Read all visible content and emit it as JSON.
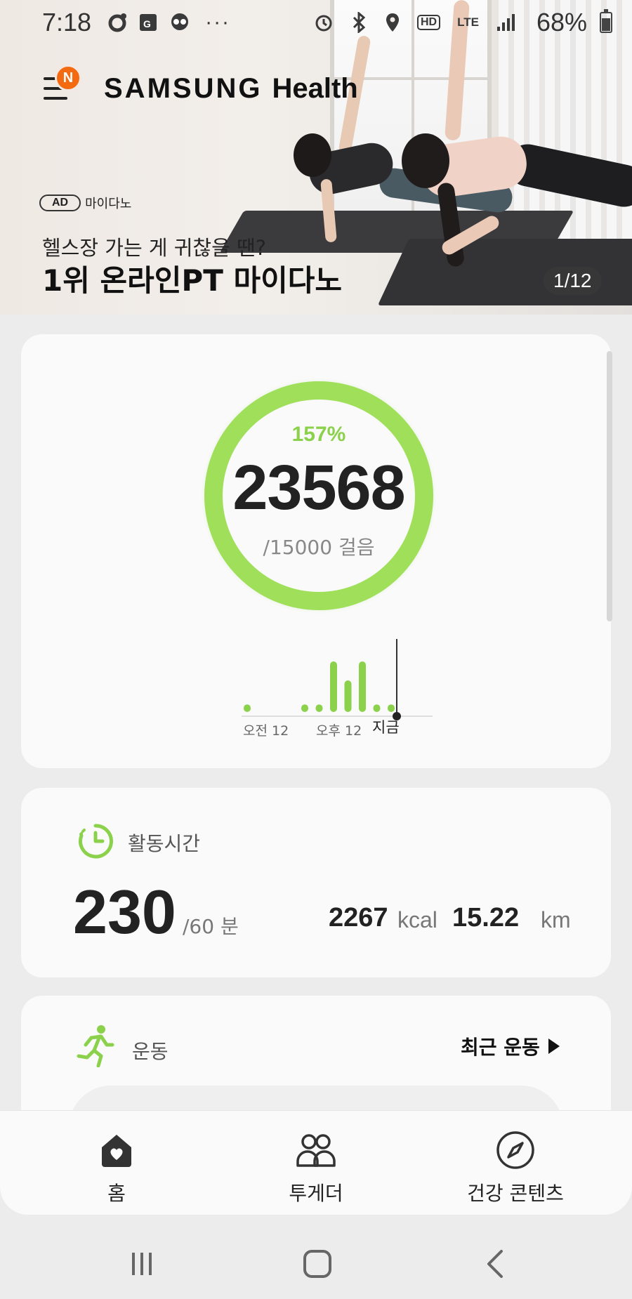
{
  "status_bar": {
    "time": "7:18",
    "icons_left": [
      "sync-icon",
      "map-icon",
      "skull-icon"
    ],
    "more": "···",
    "icons_right": [
      "alarm-icon",
      "bluetooth-icon",
      "location-icon",
      "hd-icon",
      "lte-icon",
      "signal-icon"
    ],
    "lte": "LTE",
    "hd": "HD",
    "battery": "68%"
  },
  "header": {
    "app_name_brand": "SAMSUNG",
    "app_name_product": "Health",
    "menu_badge": "N"
  },
  "banner": {
    "ad_label": "AD",
    "advertiser": "마이다노",
    "subtitle": "헬스장 가는 게 귀찮을 땐?",
    "title": "1위 온라인PT 마이다노",
    "pager": "1/12"
  },
  "steps": {
    "percent": "157%",
    "count": "23568",
    "goal": "/15000 걸음",
    "progress_fraction": 1.0,
    "chart": {
      "labels": [
        "오전 12",
        "오후 12",
        "지금"
      ],
      "bar_levels": [
        0.12,
        0,
        0,
        0,
        0.12,
        0.12,
        0.8,
        0.5,
        0.8,
        0.12,
        0.12
      ],
      "accent": "#8bd14b"
    }
  },
  "active_time": {
    "label": "활동시간",
    "value": "230",
    "goal": "/60 분",
    "kcal_value": "2267",
    "kcal_unit": "kcal",
    "km_value": "15.22",
    "km_unit": "km"
  },
  "exercise": {
    "label": "운동",
    "recent_link": "최근 운동"
  },
  "bottom_nav": {
    "items": [
      {
        "label": "홈",
        "icon": "home-heart-icon"
      },
      {
        "label": "투게더",
        "icon": "people-icon"
      },
      {
        "label": "건강 콘텐츠",
        "icon": "compass-icon"
      }
    ]
  },
  "system_nav": [
    "recents-icon",
    "home-icon",
    "back-icon"
  ],
  "colors": {
    "accent_green": "#8bd14b",
    "badge_orange": "#f36a11",
    "card_bg": "#fafafa",
    "page_bg": "#ececec"
  }
}
